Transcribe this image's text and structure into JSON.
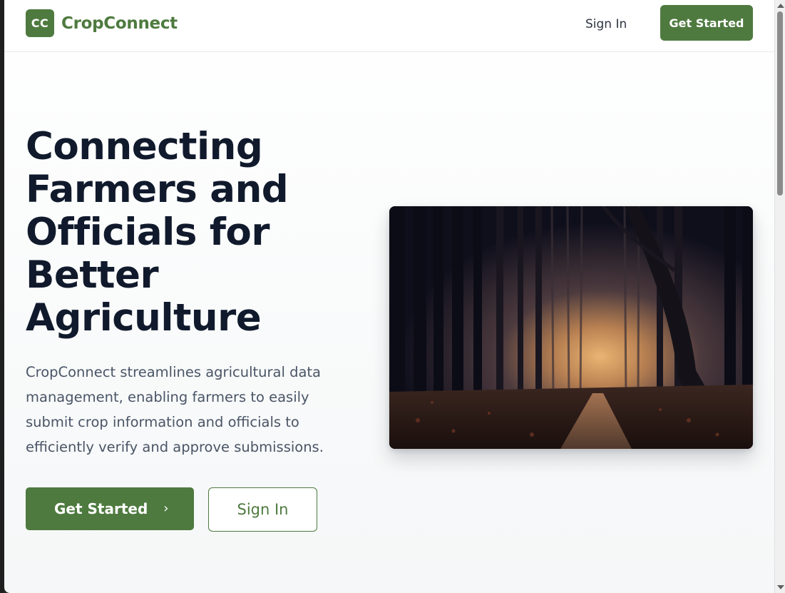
{
  "header": {
    "logo_badge": "CC",
    "logo_text": "CropConnect",
    "nav_signin": "Sign In",
    "nav_getstarted": "Get Started"
  },
  "hero": {
    "title": "Connecting Farmers and Officials for Better Agriculture",
    "description": "CropConnect streamlines agricultural data management, enabling farmers to easily submit crop information and officials to efficiently verify and approve submissions.",
    "primary_button": "Get Started",
    "primary_button_icon": "chevron-right-icon",
    "secondary_button": "Sign In",
    "image": "misty-forest-path-image"
  },
  "colors": {
    "brand_green": "#4e7a3f",
    "heading": "#101a2c",
    "body_text": "#4a5566"
  }
}
